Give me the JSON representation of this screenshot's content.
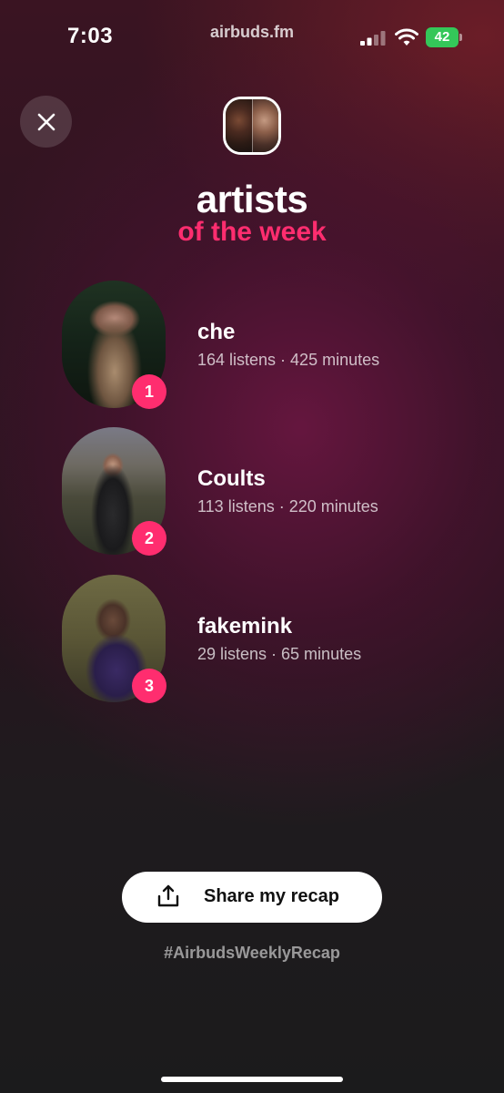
{
  "status_bar": {
    "time": "7:03",
    "url": "airbuds.fm",
    "battery": "42"
  },
  "header": {
    "title": "artists",
    "subtitle": "of the week"
  },
  "artists": [
    {
      "rank": "1",
      "name": "che",
      "stats": "164 listens · 425 minutes"
    },
    {
      "rank": "2",
      "name": "Coults",
      "stats": "113 listens · 220 minutes"
    },
    {
      "rank": "3",
      "name": "fakemink",
      "stats": "29 listens · 65 minutes"
    }
  ],
  "share": {
    "label": "Share my recap",
    "hashtag": "#AirbudsWeeklyRecap"
  },
  "colors": {
    "accent": "#ff2d6f",
    "battery": "#34c759"
  },
  "icons": {
    "close": "close-icon",
    "share": "share-icon"
  }
}
